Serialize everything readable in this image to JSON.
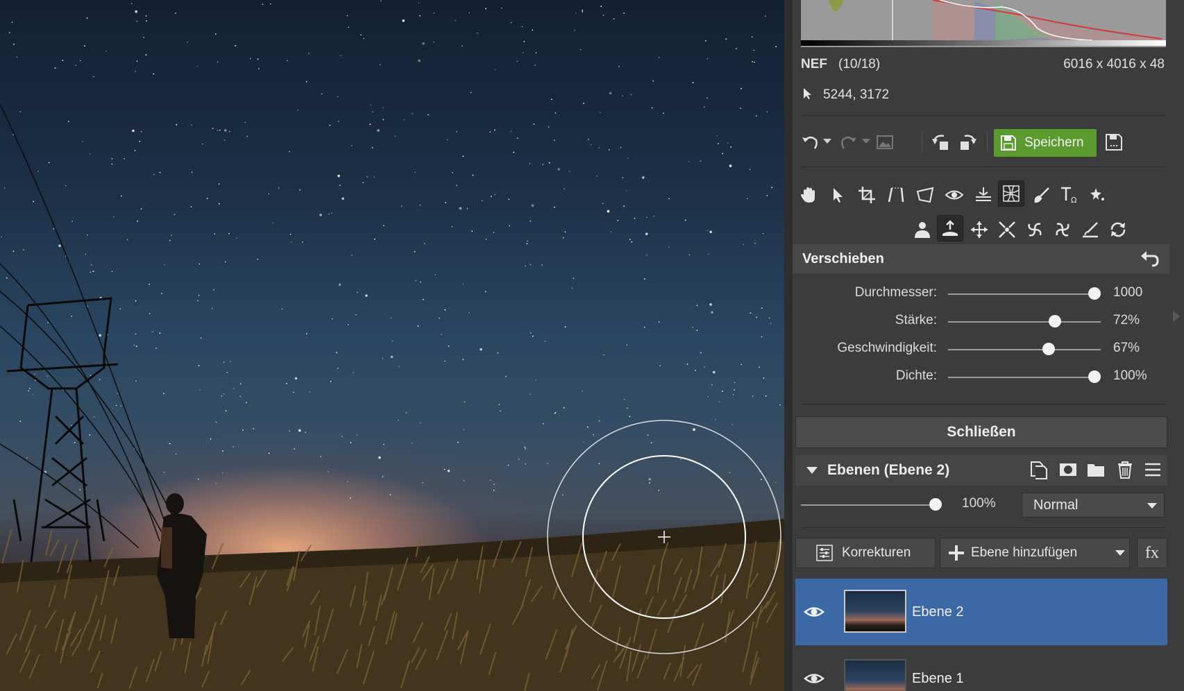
{
  "info": {
    "format": "NEF",
    "position": "(10/18)",
    "dimensions": "6016 x 4016 x 48",
    "cursor_coords": "5244, 3172"
  },
  "toolbar": {
    "save_label": "Speichern",
    "icons": [
      "undo-icon",
      "redo-icon",
      "image-icon",
      "rotate-left-icon",
      "rotate-right-icon",
      "save-icon",
      "save-as-icon"
    ]
  },
  "tools": {
    "row1": [
      "hand-icon",
      "pointer-icon",
      "crop-icon",
      "straighten-icon",
      "perspective-icon",
      "eye-icon",
      "level-icon",
      "liquify-icon",
      "brush-icon",
      "text-icon",
      "effects-icon"
    ],
    "row2": [
      "person-icon",
      "push-icon",
      "move-icon",
      "pinch-icon",
      "twirl-left-icon",
      "twirl-right-icon",
      "smear-icon",
      "reset-icon"
    ]
  },
  "tool_panel": {
    "title": "Verschieben",
    "sliders": [
      {
        "label": "Durchmesser:",
        "value": "1000",
        "fraction": 0.96
      },
      {
        "label": "Stärke:",
        "value": "72%",
        "fraction": 0.7
      },
      {
        "label": "Geschwindigkeit:",
        "value": "67%",
        "fraction": 0.66
      },
      {
        "label": "Dichte:",
        "value": "100%",
        "fraction": 0.96
      }
    ],
    "close_label": "Schließen"
  },
  "layers": {
    "title": "Ebenen (Ebene 2)",
    "opacity": "100%",
    "opacity_fraction": 1.0,
    "blend_mode": "Normal",
    "corrections_label": "Korrekturen",
    "add_layer_label": "Ebene hinzufügen",
    "fx_label": "fx",
    "items": [
      {
        "name": "Ebene 2",
        "selected": true
      },
      {
        "name": "Ebene 1",
        "selected": false
      }
    ]
  },
  "colors": {
    "accent_green": "#5b9a2e",
    "selection_blue": "#3c68a6",
    "panel_bg": "#3c3c3c"
  }
}
